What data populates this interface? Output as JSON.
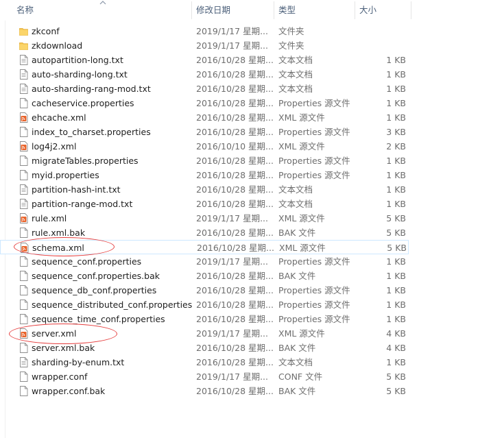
{
  "columns": {
    "name": "名称",
    "date": "修改日期",
    "type": "类型",
    "size": "大小"
  },
  "files": [
    {
      "name": "zkconf",
      "date": "2019/1/17 星期...",
      "type": "文件夹",
      "size": "",
      "icon": "folder"
    },
    {
      "name": "zkdownload",
      "date": "2019/1/17 星期...",
      "type": "文件夹",
      "size": "",
      "icon": "folder"
    },
    {
      "name": "autopartition-long.txt",
      "date": "2016/10/28 星期...",
      "type": "文本文档",
      "size": "1 KB",
      "icon": "text"
    },
    {
      "name": "auto-sharding-long.txt",
      "date": "2016/10/28 星期...",
      "type": "文本文档",
      "size": "1 KB",
      "icon": "text"
    },
    {
      "name": "auto-sharding-rang-mod.txt",
      "date": "2016/10/28 星期...",
      "type": "文本文档",
      "size": "1 KB",
      "icon": "text"
    },
    {
      "name": "cacheservice.properties",
      "date": "2016/10/28 星期...",
      "type": "Properties 源文件",
      "size": "1 KB",
      "icon": "file"
    },
    {
      "name": "ehcache.xml",
      "date": "2016/10/28 星期...",
      "type": "XML 源文件",
      "size": "1 KB",
      "icon": "xml"
    },
    {
      "name": "index_to_charset.properties",
      "date": "2016/10/28 星期...",
      "type": "Properties 源文件",
      "size": "3 KB",
      "icon": "file"
    },
    {
      "name": "log4j2.xml",
      "date": "2016/10/10 星期...",
      "type": "XML 源文件",
      "size": "2 KB",
      "icon": "xml"
    },
    {
      "name": "migrateTables.properties",
      "date": "2016/10/28 星期...",
      "type": "Properties 源文件",
      "size": "1 KB",
      "icon": "file"
    },
    {
      "name": "myid.properties",
      "date": "2016/10/28 星期...",
      "type": "Properties 源文件",
      "size": "1 KB",
      "icon": "file"
    },
    {
      "name": "partition-hash-int.txt",
      "date": "2016/10/28 星期...",
      "type": "文本文档",
      "size": "1 KB",
      "icon": "text"
    },
    {
      "name": "partition-range-mod.txt",
      "date": "2016/10/28 星期...",
      "type": "文本文档",
      "size": "1 KB",
      "icon": "text"
    },
    {
      "name": "rule.xml",
      "date": "2019/1/17 星期...",
      "type": "XML 源文件",
      "size": "5 KB",
      "icon": "xml"
    },
    {
      "name": "rule.xml.bak",
      "date": "2016/10/28 星期...",
      "type": "BAK 文件",
      "size": "5 KB",
      "icon": "file"
    },
    {
      "name": "schema.xml",
      "date": "2016/10/28 星期...",
      "type": "XML 源文件",
      "size": "5 KB",
      "icon": "xml",
      "hover": true
    },
    {
      "name": "sequence_conf.properties",
      "date": "2019/1/17 星期...",
      "type": "Properties 源文件",
      "size": "1 KB",
      "icon": "file"
    },
    {
      "name": "sequence_conf.properties.bak",
      "date": "2016/10/28 星期...",
      "type": "BAK 文件",
      "size": "1 KB",
      "icon": "file"
    },
    {
      "name": "sequence_db_conf.properties",
      "date": "2016/10/28 星期...",
      "type": "Properties 源文件",
      "size": "1 KB",
      "icon": "file"
    },
    {
      "name": "sequence_distributed_conf.properties",
      "date": "2016/10/28 星期...",
      "type": "Properties 源文件",
      "size": "1 KB",
      "icon": "file"
    },
    {
      "name": "sequence_time_conf.properties",
      "date": "2016/10/28 星期...",
      "type": "Properties 源文件",
      "size": "1 KB",
      "icon": "file"
    },
    {
      "name": "server.xml",
      "date": "2019/1/17 星期...",
      "type": "XML 源文件",
      "size": "4 KB",
      "icon": "xml"
    },
    {
      "name": "server.xml.bak",
      "date": "2016/10/28 星期...",
      "type": "BAK 文件",
      "size": "4 KB",
      "icon": "file"
    },
    {
      "name": "sharding-by-enum.txt",
      "date": "2016/10/28 星期...",
      "type": "文本文档",
      "size": "1 KB",
      "icon": "text"
    },
    {
      "name": "wrapper.conf",
      "date": "2019/1/17 星期...",
      "type": "CONF 文件",
      "size": "5 KB",
      "icon": "file"
    },
    {
      "name": "wrapper.conf.bak",
      "date": "2016/10/28 星期...",
      "type": "BAK 文件",
      "size": "5 KB",
      "icon": "file"
    }
  ],
  "colors": {
    "header_text": "#4c607a",
    "folder": "#f7c651",
    "xml_icon": "#e8632b",
    "annotation": "#e53c3c",
    "hover_border": "#cde8ff"
  }
}
